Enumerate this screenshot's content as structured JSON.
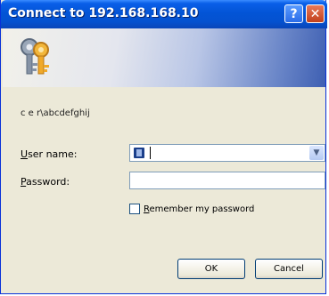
{
  "window": {
    "title": "Connect to 192.168.168.10",
    "help_glyph": "?",
    "close_glyph": "✕"
  },
  "banner": {
    "icon": "keys-icon"
  },
  "dialog": {
    "realm_text": "c e r\\abcdefghij",
    "username_label_first": "U",
    "username_label_rest": "ser name:",
    "username_value": "",
    "password_label_first": "P",
    "password_label_rest": "assword:",
    "password_value": "",
    "remember_label_first": "R",
    "remember_label_rest": "emember my password",
    "remember_checked": false,
    "ok_label": "OK",
    "cancel_label": "Cancel"
  },
  "colors": {
    "title_bar": "#0354d6",
    "dialog_bg": "#ece9d8",
    "close_button": "#c1401c"
  }
}
